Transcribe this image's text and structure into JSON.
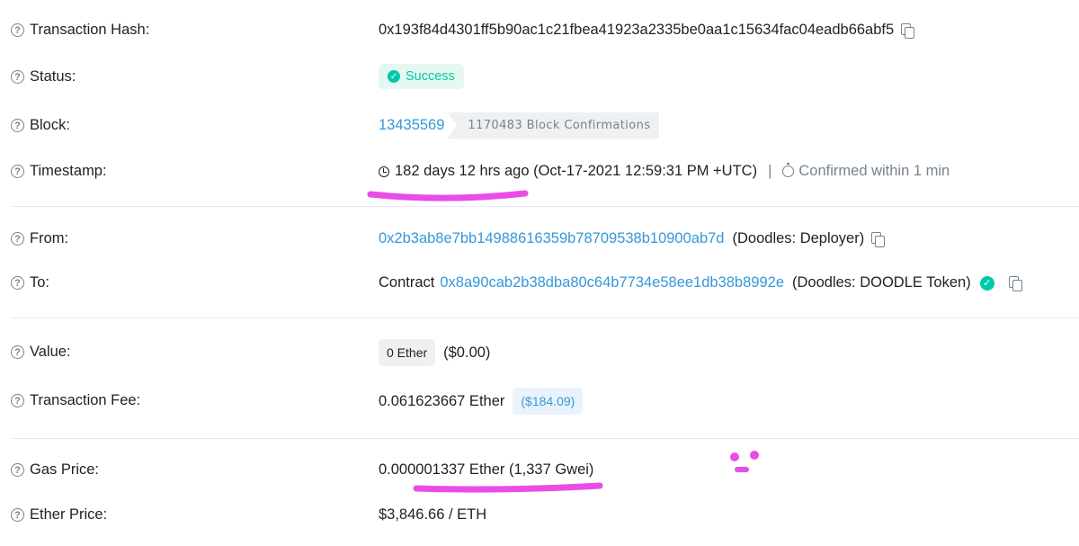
{
  "rows": {
    "hash": {
      "label": "Transaction Hash:",
      "value": "0x193f84d4301ff5b90ac1c21fbea41923a2335be0aa1c15634fac04eadb66abf5"
    },
    "status": {
      "label": "Status:",
      "value": "Success"
    },
    "block": {
      "label": "Block:",
      "number": "13435569",
      "confirmations": "1170483 Block Confirmations"
    },
    "timestamp": {
      "label": "Timestamp:",
      "ago": "182 days 12 hrs ago (Oct-17-2021 12:59:31 PM +UTC)",
      "separator": "|",
      "confirmed": "Confirmed within 1 min"
    },
    "from": {
      "label": "From:",
      "address": "0x2b3ab8e7bb14988616359b78709538b10900ab7d",
      "name": "(Doodles: Deployer)"
    },
    "to": {
      "label": "To:",
      "prefix": "Contract",
      "address": "0x8a90cab2b38dba80c64b7734e58ee1db38b8992e",
      "name": "(Doodles: DOODLE Token)"
    },
    "value": {
      "label": "Value:",
      "amount": "0 Ether",
      "usd": "($0.00)"
    },
    "fee": {
      "label": "Transaction Fee:",
      "amount": "0.061623667 Ether",
      "usd": "($184.09)"
    },
    "gas": {
      "label": "Gas Price:",
      "value": "0.000001337 Ether (1,337 Gwei)"
    },
    "ether_price": {
      "label": "Ether Price:",
      "value": "$3,846.66 / ETH"
    }
  },
  "help_glyph": "?",
  "icons": [
    "question-icon",
    "check-circle-icon",
    "clock-icon",
    "stopwatch-icon",
    "copy-icon",
    "verified-check-icon"
  ],
  "colors": {
    "link": "#3498db",
    "success": "#00c9a7",
    "annotation": "#e84de8"
  }
}
